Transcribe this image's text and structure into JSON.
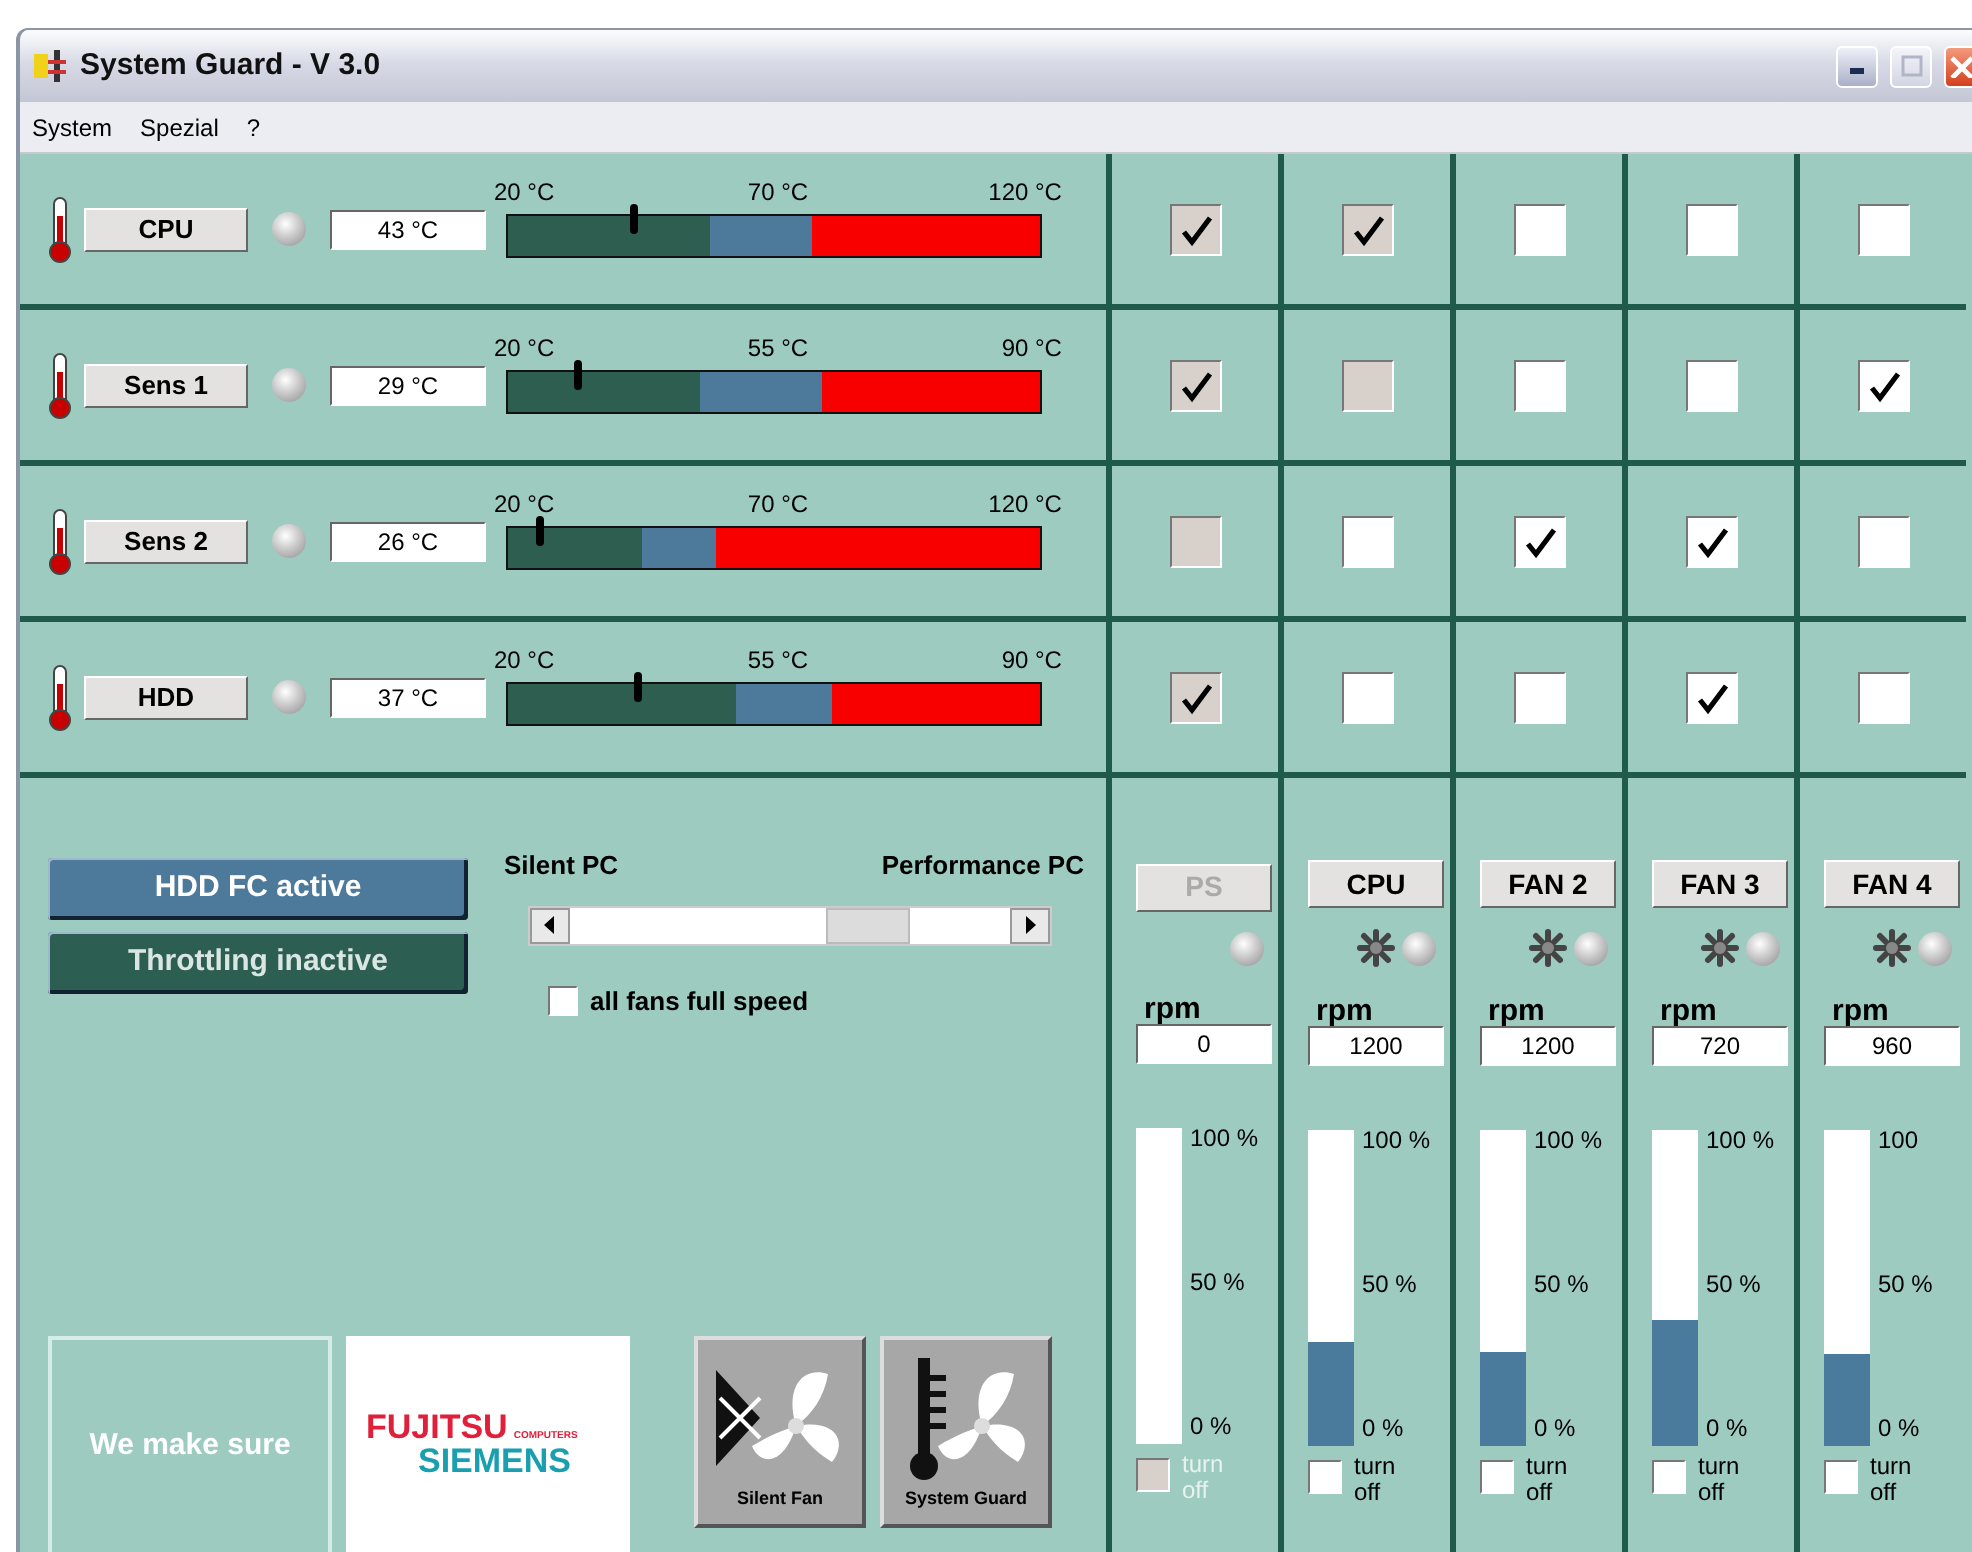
{
  "window": {
    "title": "System Guard - V 3.0"
  },
  "menu": [
    {
      "label": "System"
    },
    {
      "label": "Spezial"
    },
    {
      "label": "?"
    }
  ],
  "sensors": [
    {
      "name": "CPU",
      "value": "43 °C",
      "scale": [
        "20 °C",
        "70 °C",
        "120 °C"
      ],
      "marker": {
        "level": 0.235
      },
      "zones": [
        {
          "kind": "normal",
          "level": 0.38
        },
        {
          "kind": "warning",
          "level": 0.57
        }
      ],
      "assignments": [
        {
          "checked": true,
          "disabled": true
        },
        {
          "checked": true,
          "disabled": true
        },
        {
          "checked": false,
          "disabled": false
        },
        {
          "checked": false,
          "disabled": false
        },
        {
          "checked": false,
          "disabled": false
        }
      ]
    },
    {
      "name": "Sens 1",
      "value": "29 °C",
      "scale": [
        "20 °C",
        "55 °C",
        "90 °C"
      ],
      "marker": {
        "level": 0.13
      },
      "zones": [
        {
          "kind": "normal",
          "level": 0.36
        },
        {
          "kind": "warning",
          "level": 0.59
        }
      ],
      "assignments": [
        {
          "checked": true,
          "disabled": true
        },
        {
          "checked": false,
          "disabled": true
        },
        {
          "checked": false,
          "disabled": false
        },
        {
          "checked": false,
          "disabled": false
        },
        {
          "checked": true,
          "disabled": false
        }
      ]
    },
    {
      "name": "Sens 2",
      "value": "26 °C",
      "scale": [
        "20 °C",
        "70 °C",
        "120 °C"
      ],
      "marker": {
        "level": 0.06
      },
      "zones": [
        {
          "kind": "normal",
          "level": 0.25
        },
        {
          "kind": "warning",
          "level": 0.39
        }
      ],
      "assignments": [
        {
          "checked": false,
          "disabled": true
        },
        {
          "checked": false,
          "disabled": false
        },
        {
          "checked": true,
          "disabled": false
        },
        {
          "checked": true,
          "disabled": false
        },
        {
          "checked": false,
          "disabled": false
        }
      ]
    },
    {
      "name": "HDD",
      "value": "37 °C",
      "scale": [
        "20 °C",
        "55 °C",
        "90 °C"
      ],
      "marker": {
        "level": 0.245
      },
      "zones": [
        {
          "kind": "normal",
          "level": 0.43
        },
        {
          "kind": "warning",
          "level": 0.61
        }
      ],
      "assignments": [
        {
          "checked": true,
          "disabled": true
        },
        {
          "checked": false,
          "disabled": false
        },
        {
          "checked": false,
          "disabled": false
        },
        {
          "checked": true,
          "disabled": false
        },
        {
          "checked": false,
          "disabled": false
        }
      ]
    }
  ],
  "controls": {
    "status_buttons": [
      {
        "label": "HDD FC active",
        "kind": "active"
      },
      {
        "label": "Throttling inactive",
        "kind": "inactive"
      }
    ],
    "slider": {
      "left_label": "Silent PC",
      "right_label": "Performance PC",
      "level": 0.72
    },
    "full_speed": {
      "label": "all fans full speed",
      "checked": false
    }
  },
  "branding": {
    "tagline": "We make sure",
    "logo": [
      "FUJITSU",
      "COMPUTERS",
      "SIEMENS"
    ],
    "apps": [
      {
        "label": "Silent Fan",
        "kind": "silent-fan"
      },
      {
        "label": "System Guard",
        "kind": "system-guard"
      }
    ]
  },
  "fans": [
    {
      "name": "PS",
      "disabled": true,
      "fan_icon": false,
      "rpm_label": "rpm",
      "rpm": "0",
      "scale": [
        "100 %",
        "50 %",
        "0 %"
      ],
      "level": 0,
      "turn_off": {
        "label": "turn off",
        "checked": false
      }
    },
    {
      "name": "CPU",
      "disabled": false,
      "fan_icon": true,
      "rpm_label": "rpm",
      "rpm": "1200",
      "scale": [
        "100 %",
        "50 %",
        "0 %"
      ],
      "level": 0.33,
      "turn_off": {
        "label": "turn off",
        "checked": false
      }
    },
    {
      "name": "FAN 2",
      "disabled": false,
      "fan_icon": true,
      "rpm_label": "rpm",
      "rpm": "1200",
      "scale": [
        "100 %",
        "50 %",
        "0 %"
      ],
      "level": 0.3,
      "turn_off": {
        "label": "turn off",
        "checked": false
      }
    },
    {
      "name": "FAN 3",
      "disabled": false,
      "fan_icon": true,
      "rpm_label": "rpm",
      "rpm": "720",
      "scale": [
        "100 %",
        "50 %",
        "0 %"
      ],
      "level": 0.4,
      "turn_off": {
        "label": "turn off",
        "checked": false
      }
    },
    {
      "name": "FAN 4",
      "disabled": false,
      "fan_icon": true,
      "rpm_label": "rpm",
      "rpm": "960",
      "scale": [
        "100",
        "50 %",
        "0 %"
      ],
      "level": 0.29,
      "turn_off": {
        "label": "turn off",
        "checked": false
      }
    }
  ]
}
